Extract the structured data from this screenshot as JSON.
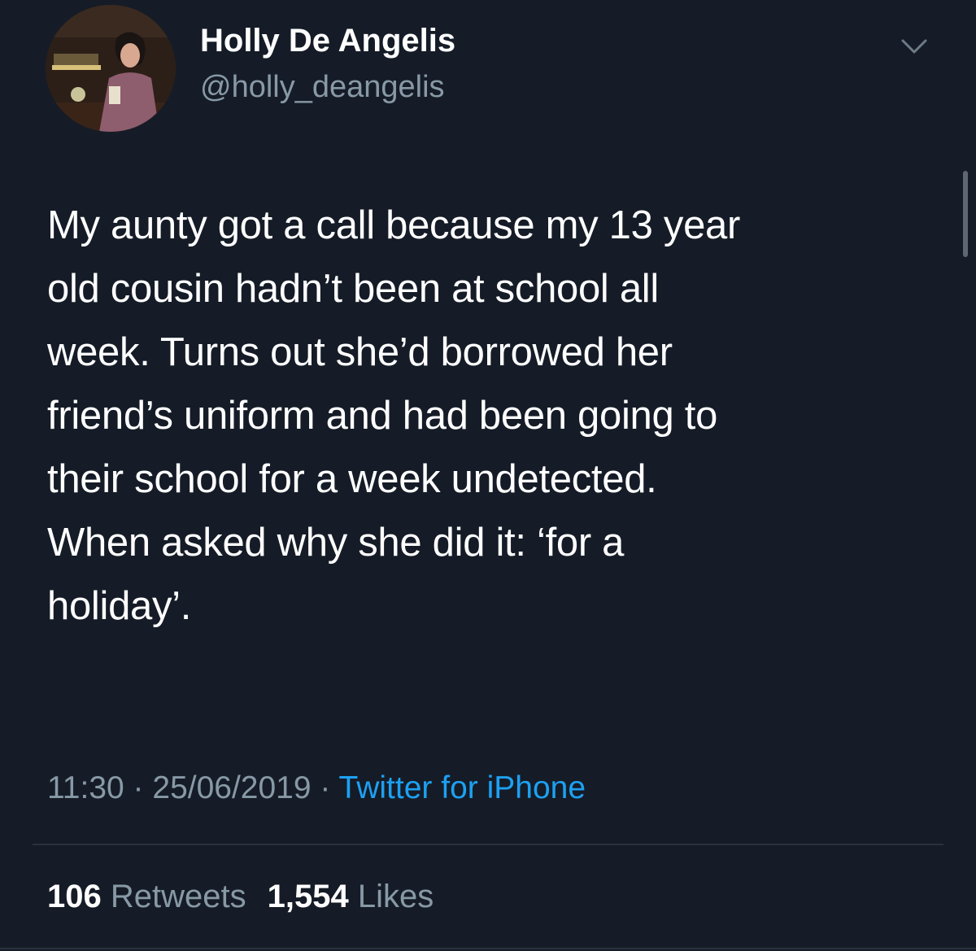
{
  "user": {
    "display_name": "Holly De Angelis",
    "handle": "@holly_deangelis"
  },
  "tweet": {
    "lines": [
      "My aunty got a call because my 13 year",
      "old cousin hadn’t been at school all",
      "week. Turns out she’d borrowed her",
      "friend’s uniform and had been going to",
      "their school for a week undetected.",
      "When asked why she did it: ‘for a",
      "holiday’."
    ]
  },
  "meta": {
    "time": "11:30",
    "separator": " · ",
    "date": "25/06/2019",
    "source": "Twitter for iPhone"
  },
  "stats": {
    "retweets_count": "106",
    "retweets_label": "Retweets",
    "likes_count": "1,554",
    "likes_label": "Likes"
  },
  "icons": {
    "avatar": "profile-photo",
    "chevron": "chevron-down-icon"
  },
  "colors": {
    "background": "#151c27",
    "secondary_text": "#8899a6",
    "link": "#1da1f2"
  }
}
